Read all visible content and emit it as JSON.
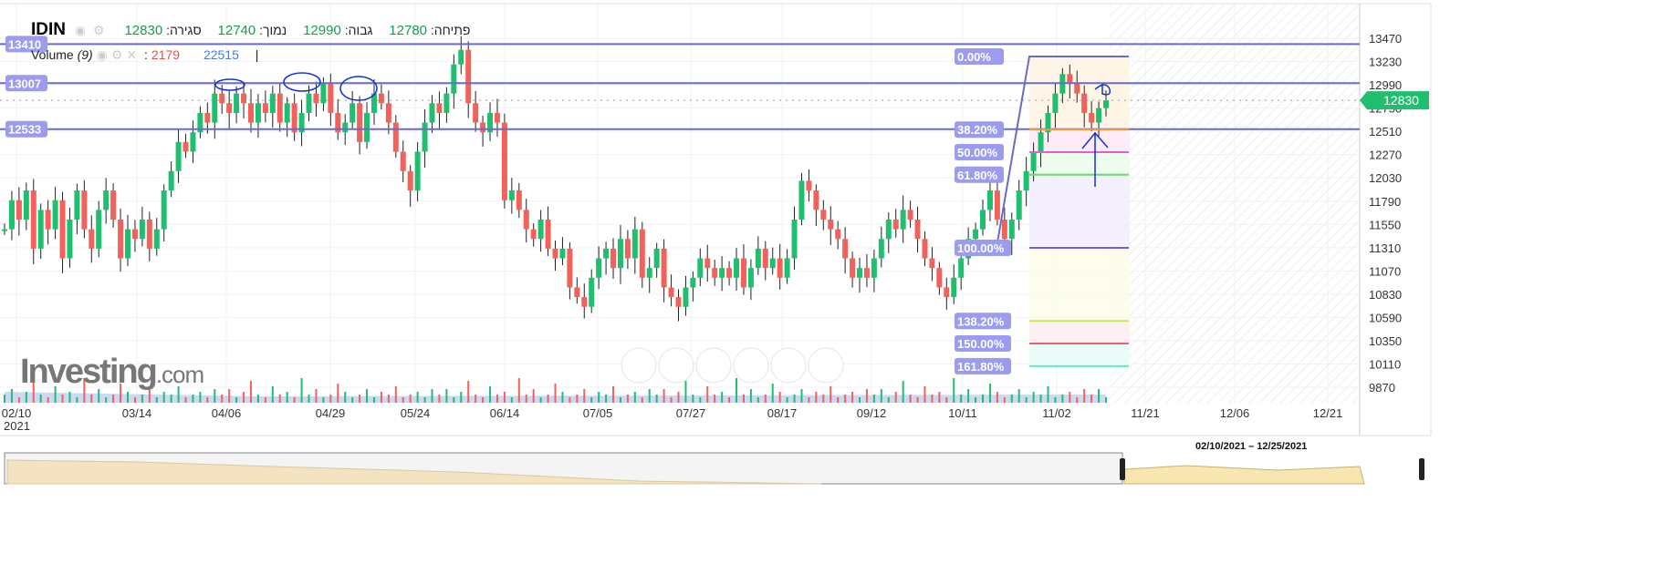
{
  "header": {
    "symbol": "IDIN",
    "close_label": "סגירה:",
    "close": "12830",
    "low_label": "נמוך:",
    "low": "12740",
    "high_label": "גבוה:",
    "high": "12990",
    "open_label": "פתיחה:",
    "open": "12780"
  },
  "volume": {
    "label": "Volume",
    "period": "(9)",
    "sep": ":",
    "value": "2179",
    "ma": "22515",
    "cursor": "|"
  },
  "logo": {
    "text": "Investing",
    "suffix": ".com"
  },
  "navigator": {
    "range": "02/10/2021 – 12/25/2021"
  },
  "colors": {
    "up": "#1fbf6f",
    "down": "#f2625a",
    "level": "#6a6ac8",
    "tag": "#9b9bf0"
  },
  "chart_data": {
    "type": "candlestick",
    "title": "IDIN",
    "y_ticks": [
      13470,
      13230,
      12990,
      12750,
      12510,
      12270,
      12030,
      11790,
      11550,
      11310,
      11070,
      10830,
      10590,
      10350,
      10110,
      9870
    ],
    "ylim": [
      9750,
      13520
    ],
    "x_ticks": [
      "02/10",
      "03/14",
      "04/06",
      "04/29",
      "05/24",
      "06/14",
      "07/05",
      "07/27",
      "08/17",
      "09/12",
      "10/11",
      "11/02",
      "11/21",
      "12/06",
      "12/21"
    ],
    "x_year": "2021",
    "current_price": "12830",
    "horizontal_levels": [
      {
        "label": "13410",
        "value": 13410
      },
      {
        "label": "13007",
        "value": 13007
      },
      {
        "label": "12533",
        "value": 12533
      }
    ],
    "fibonacci": {
      "high": 13282,
      "low": 11308,
      "levels": [
        {
          "label": "0.00%",
          "ratio": 0,
          "color": "#6a6ac8"
        },
        {
          "label": "38.20%",
          "ratio": 0.382,
          "color": "#f0a040"
        },
        {
          "label": "50.00%",
          "ratio": 0.5,
          "color": "#e060d0"
        },
        {
          "label": "61.80%",
          "ratio": 0.618,
          "color": "#60e060"
        },
        {
          "label": "100.00%",
          "ratio": 1,
          "color": "#7a5ae0"
        },
        {
          "label": "138.20%",
          "ratio": 1.382,
          "color": "#c8e860"
        },
        {
          "label": "150.00%",
          "ratio": 1.5,
          "color": "#f06070"
        },
        {
          "label": "161.80%",
          "ratio": 1.618,
          "color": "#60e8d0"
        }
      ]
    },
    "closes": [
      11500,
      11800,
      11600,
      11900,
      11300,
      11700,
      11500,
      11800,
      11200,
      11600,
      11900,
      11500,
      11300,
      11700,
      11900,
      11600,
      11200,
      11500,
      11400,
      11600,
      11300,
      11500,
      11900,
      12100,
      12400,
      12300,
      12500,
      12700,
      12600,
      12900,
      12800,
      12700,
      12900,
      12800,
      12600,
      12800,
      12700,
      12900,
      12600,
      12800,
      12500,
      12700,
      12900,
      12800,
      13000,
      12700,
      12500,
      12600,
      12800,
      12400,
      12700,
      12900,
      12800,
      12600,
      12300,
      12100,
      11900,
      12300,
      12600,
      12800,
      12700,
      12900,
      13200,
      13350,
      12800,
      12600,
      12500,
      12700,
      12600,
      11800,
      11900,
      11700,
      11500,
      11400,
      11600,
      11300,
      11200,
      11300,
      10900,
      10800,
      10700,
      11000,
      11200,
      11300,
      11100,
      11400,
      11200,
      11500,
      11000,
      11100,
      11300,
      10900,
      10800,
      10700,
      10900,
      11000,
      11200,
      11100,
      11000,
      11100,
      11000,
      11200,
      10900,
      11100,
      11300,
      11100,
      11200,
      11000,
      11200,
      11600,
      12000,
      11900,
      11700,
      11600,
      11500,
      11400,
      11200,
      11000,
      11100,
      11000,
      11200,
      11400,
      11600,
      11500,
      11700,
      11600,
      11400,
      11200,
      11100,
      10900,
      10800,
      11000,
      11200,
      11400,
      11500,
      11700,
      11900,
      11600,
      11400,
      11600,
      11900,
      12100,
      12300,
      12500,
      12700,
      12900,
      13100,
      13000,
      12900,
      12700,
      12600,
      12750,
      12830
    ],
    "volume_pattern": [
      3,
      5,
      2,
      4,
      8,
      3,
      2,
      6,
      3,
      4,
      2,
      9,
      3,
      5,
      2,
      3,
      7,
      4,
      2,
      3,
      5,
      2,
      4,
      3,
      6,
      2,
      3,
      4,
      2,
      5
    ]
  }
}
